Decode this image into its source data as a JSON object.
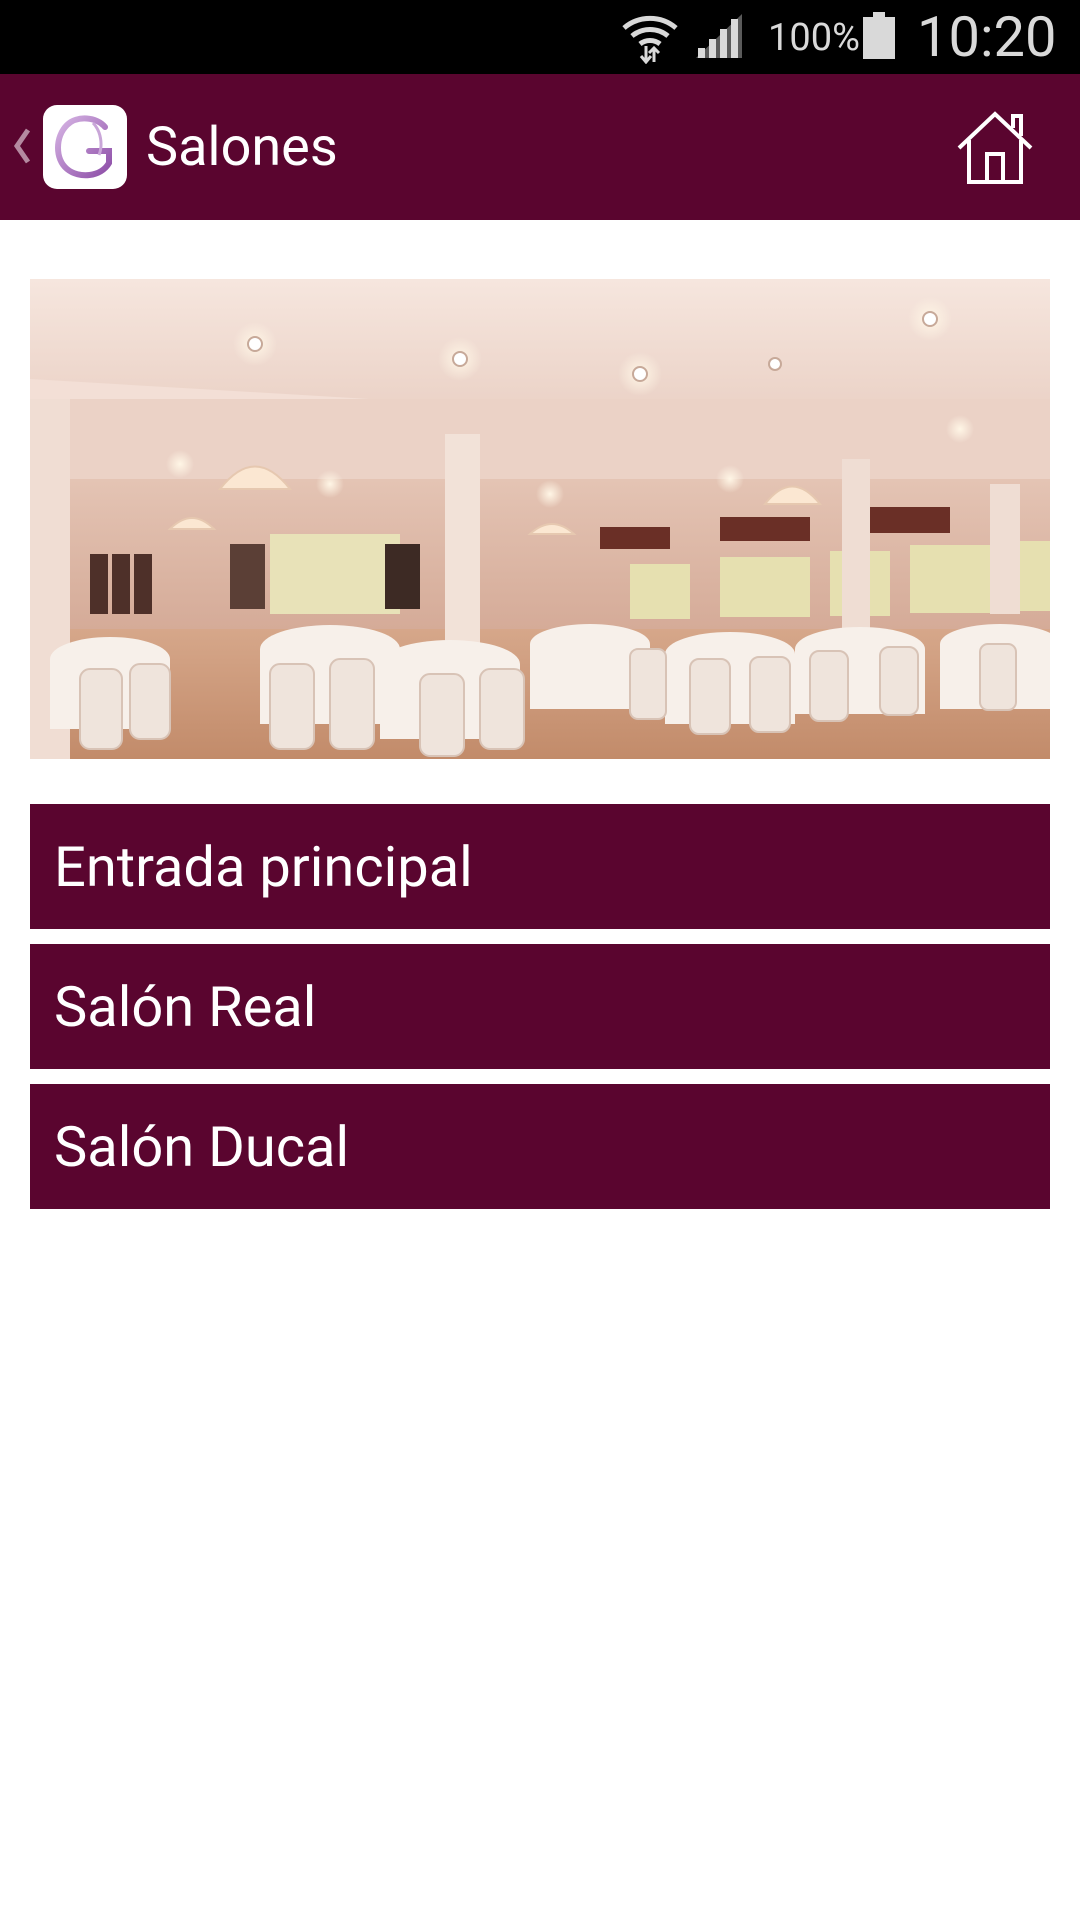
{
  "status_bar": {
    "battery_percent": "100%",
    "time": "10:20",
    "icons": [
      "wifi-icon",
      "signal-icon",
      "battery-icon"
    ]
  },
  "app_bar": {
    "title": "Salones",
    "icons": [
      "back-chevron-icon",
      "app-logo-icon",
      "home-icon"
    ]
  },
  "salons": [
    {
      "label": "Entrada principal"
    },
    {
      "label": "Salón Real"
    },
    {
      "label": "Salón Ducal"
    }
  ],
  "colors": {
    "primary": "#5a052f",
    "status_bar": "#000000",
    "background": "#ffffff"
  }
}
